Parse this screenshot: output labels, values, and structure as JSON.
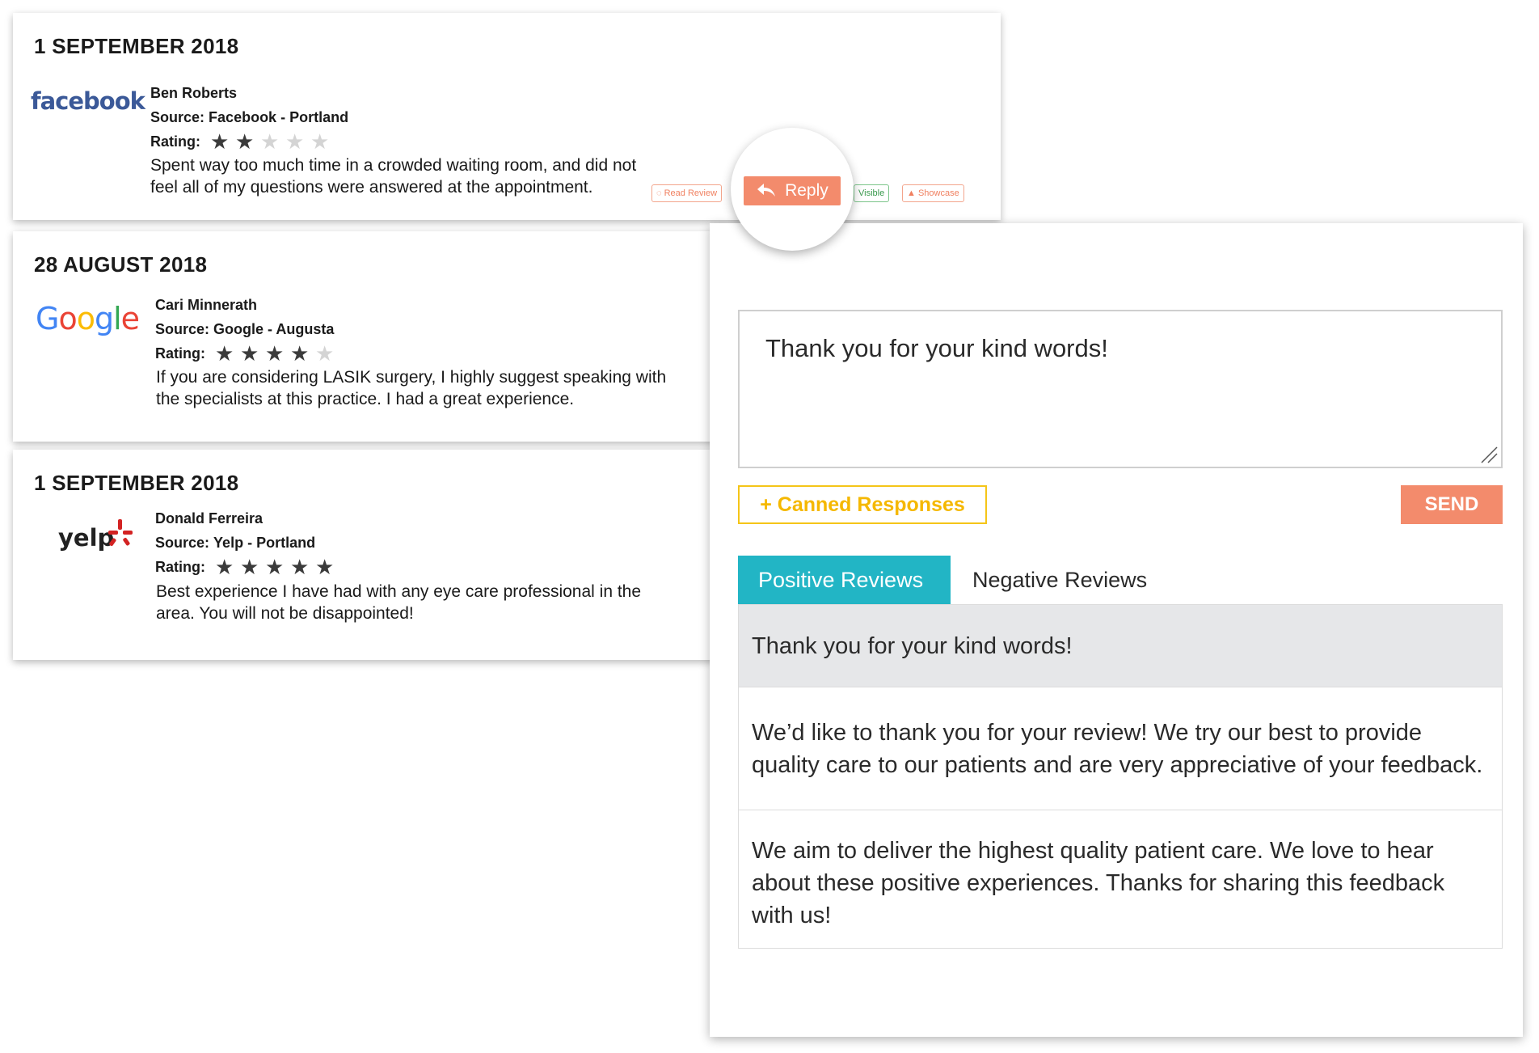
{
  "reviews": [
    {
      "date": "1 SEPTEMBER 2018",
      "logo": "facebook",
      "name": "Ben Roberts",
      "source_label": "Source:",
      "source": "Facebook - Portland",
      "rating_label": "Rating:",
      "rating": 2,
      "text": "Spent way too much time in a crowded waiting room, and did not feel all of my questions were answered at the appointment."
    },
    {
      "date": "28 AUGUST 2018",
      "logo": "Google",
      "name": "Cari Minnerath",
      "source_label": "Source:",
      "source": "Google - Augusta",
      "rating_label": "Rating:",
      "rating": 4,
      "text": "If you are considering LASIK surgery, I highly suggest speaking with the specialists at this practice. I had a great experience."
    },
    {
      "date": "1 SEPTEMBER 2018",
      "logo": "yelp",
      "name": "Donald Ferreira",
      "source_label": "Source:",
      "source": "Yelp - Portland",
      "rating_label": "Rating:",
      "rating": 5,
      "text": "Best experience I have had with any eye care professional in the area. You will not be disappointed!"
    }
  ],
  "actions": {
    "read_review": "Read Review",
    "reply": "Reply",
    "visible": "Visible",
    "showcase": "Showcase"
  },
  "reply_panel": {
    "textarea_value": "Thank you for your kind words!",
    "canned_label": "+ Canned Responses",
    "send_label": "SEND",
    "tabs": [
      "Positive Reviews",
      "Negative Reviews"
    ],
    "responses": [
      "Thank you for your kind words!",
      "We’d like to thank you for your review! We try our best to provide quality care to our patients and are very appreciative of your feedback.",
      "We aim to deliver the highest quality patient care. We love to hear about these positive experiences. Thanks for sharing this feedback with us!"
    ]
  },
  "colors": {
    "accent_orange": "#f38b6c",
    "tab_teal": "#22b5c5",
    "canned_yellow": "#f5c518",
    "facebook_blue": "#3b5998",
    "yelp_red": "#d32323"
  }
}
